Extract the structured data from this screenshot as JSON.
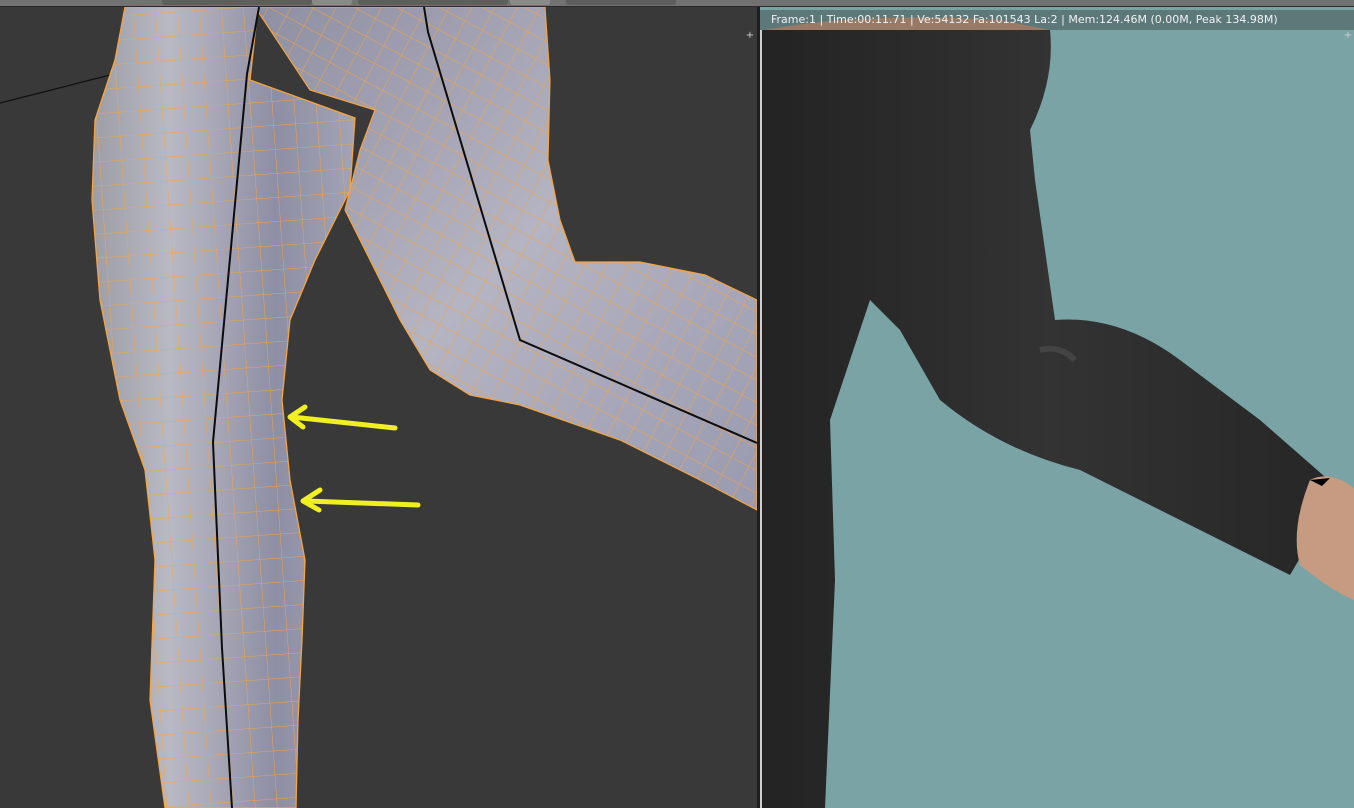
{
  "render": {
    "stats": "Frame:1 | Time:00:11.71 | Ve:54132 Fa:101543 La:2 | Mem:124.46M (0.00M, Peak 134.98M)"
  },
  "icons": {
    "corner_plus": "+",
    "arrow_upper": "arrow-icon",
    "arrow_lower": "arrow-icon"
  },
  "colors": {
    "viewport_bg": "#393939",
    "mesh_wire": "#f5a440",
    "annotation_arrow": "#f0f020",
    "render_bg": "#79a3a4",
    "pants": "#2b2b2b"
  }
}
